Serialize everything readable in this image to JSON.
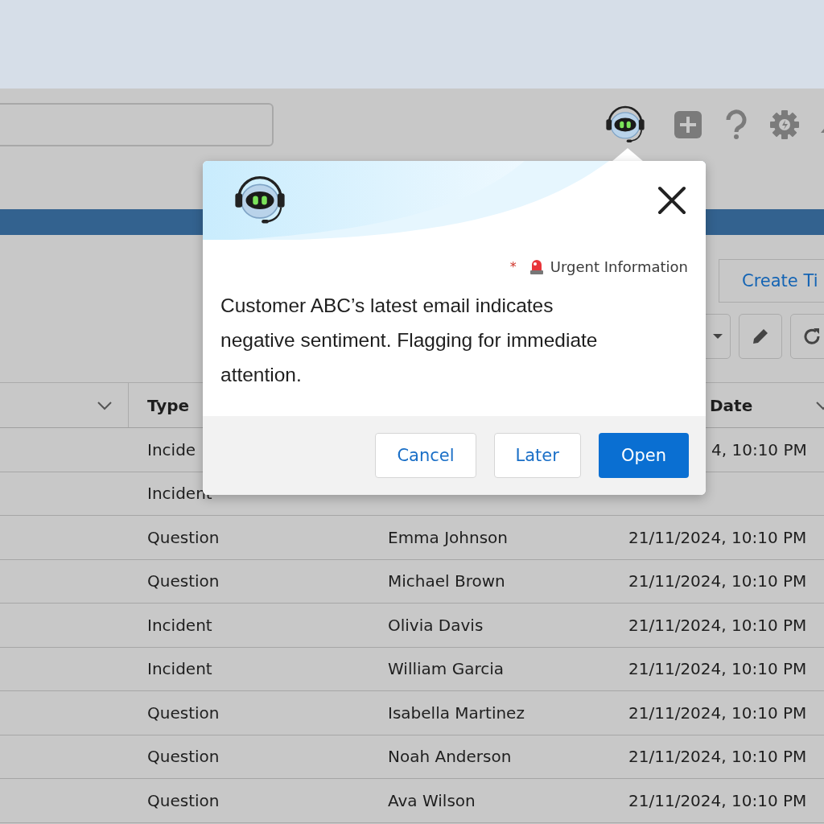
{
  "toolbar": {
    "create_button": "Create Ti"
  },
  "table": {
    "columns": [
      "Type",
      "Date"
    ],
    "rows": [
      {
        "type": "Incide",
        "date": "4, 10:10 PM"
      },
      {
        "type": "Incident"
      },
      {
        "type": "Question",
        "name": "Emma Johnson",
        "date": "21/11/2024, 10:10 PM"
      },
      {
        "type": "Question",
        "name": "Michael Brown",
        "date": "21/11/2024, 10:10 PM"
      },
      {
        "type": "Incident",
        "name": "Olivia Davis",
        "date": "21/11/2024, 10:10 PM"
      },
      {
        "type": "Incident",
        "name": "William Garcia",
        "date": "21/11/2024, 10:10 PM"
      },
      {
        "type": "Question",
        "name": "Isabella Martinez",
        "date": "21/11/2024, 10:10 PM"
      },
      {
        "type": "Question",
        "name": "Noah Anderson",
        "date": "21/11/2024, 10:10 PM"
      },
      {
        "type": "Question",
        "name": "Ava Wilson",
        "date": "21/11/2024, 10:10 PM"
      }
    ]
  },
  "popup": {
    "required_marker": "*",
    "tag_label": "Urgent Information",
    "message": "Customer ABC’s latest email indicates negative sentiment. Flagging for immediate attention.",
    "buttons": [
      {
        "label": "Cancel",
        "kind": "secondary"
      },
      {
        "label": "Later",
        "kind": "secondary"
      },
      {
        "label": "Open",
        "kind": "primary"
      }
    ]
  }
}
